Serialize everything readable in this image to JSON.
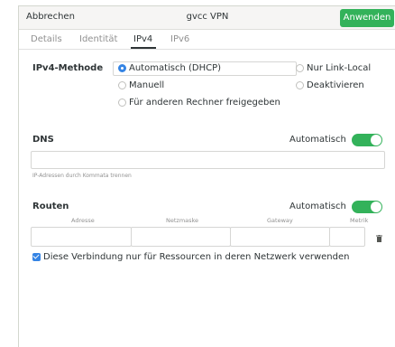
{
  "header": {
    "cancel_label": "Abbrechen",
    "title": "gvcc VPN",
    "apply_label": "Anwenden"
  },
  "tabs": [
    {
      "label": "Details"
    },
    {
      "label": "Identität"
    },
    {
      "label": "IPv4",
      "active": true
    },
    {
      "label": "IPv6"
    }
  ],
  "ipv4": {
    "method_label": "IPv4-Methode",
    "methods": [
      {
        "label": "Automatisch (DHCP)",
        "selected": true
      },
      {
        "label": "Nur Link-Local",
        "selected": false
      },
      {
        "label": "Manuell",
        "selected": false
      },
      {
        "label": "Deaktivieren",
        "selected": false
      },
      {
        "label": "Für anderen Rechner freigegeben",
        "selected": false
      }
    ]
  },
  "dns": {
    "label": "DNS",
    "auto_label": "Automatisch",
    "auto_on": true,
    "value": "",
    "hint": "IP-Adressen durch Kommata trennen"
  },
  "routes": {
    "label": "Routen",
    "auto_label": "Automatisch",
    "auto_on": true,
    "columns": [
      "Adresse",
      "Netzmaske",
      "Gateway",
      "Metrik"
    ]
  },
  "only_for_resources": {
    "label": "Diese Verbindung nur für Ressourcen in deren Netzwerk verwenden",
    "checked": true
  },
  "colors": {
    "accent_green": "#33b25a",
    "accent_blue": "#3584e4"
  }
}
